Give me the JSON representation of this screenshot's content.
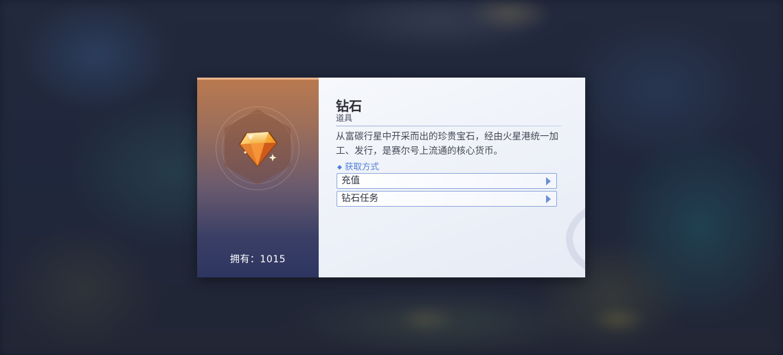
{
  "item": {
    "name": "钻石",
    "type": "道具",
    "description": "从富碳行星中开采而出的珍贵宝石，经由火星港统一加工、发行，是赛尔号上流通的核心货币。",
    "icon": "diamond-gem-icon",
    "owned_label": "拥有：1015"
  },
  "sources": {
    "header": "获取方式",
    "header_icon": "diamond-bullet-icon",
    "items": [
      {
        "label": "充值",
        "icon": "arrow-right-icon"
      },
      {
        "label": "钻石任务",
        "icon": "arrow-right-icon"
      }
    ]
  },
  "colors": {
    "accent": "#4e7fd8",
    "left_panel_top": "#bb7a4f",
    "left_panel_bottom": "#2d3560",
    "button_border": "#8da8db"
  }
}
